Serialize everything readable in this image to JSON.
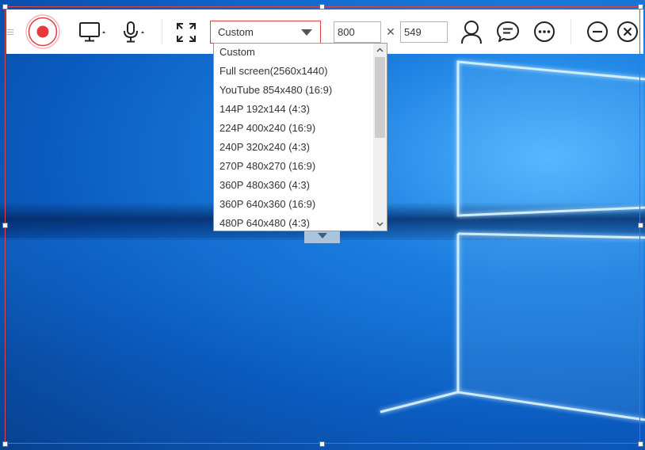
{
  "toolbar": {
    "size_preset": {
      "selected": "Custom"
    },
    "width_value": "800",
    "height_value": "549",
    "times_symbol": "✕"
  },
  "dropdown": {
    "options": [
      "Custom",
      "Full screen(2560x1440)",
      "YouTube 854x480 (16:9)",
      "144P 192x144 (4:3)",
      "224P 400x240 (16:9)",
      "240P 320x240 (4:3)",
      "270P 480x270 (16:9)",
      "360P 480x360 (4:3)",
      "360P 640x360 (16:9)",
      "480P 640x480 (4:3)"
    ]
  },
  "icons": {
    "grip": "drag-handle-icon",
    "record": "record-icon",
    "screen": "monitor-icon",
    "mic": "microphone-icon",
    "fullscreen": "expand-icon",
    "user": "user-icon",
    "chat": "chat-bubble-icon",
    "more": "more-icon",
    "minimize": "minimize-icon",
    "close": "close-icon"
  },
  "colors": {
    "accent_red": "#e0424a",
    "record_red": "#e8383d"
  }
}
